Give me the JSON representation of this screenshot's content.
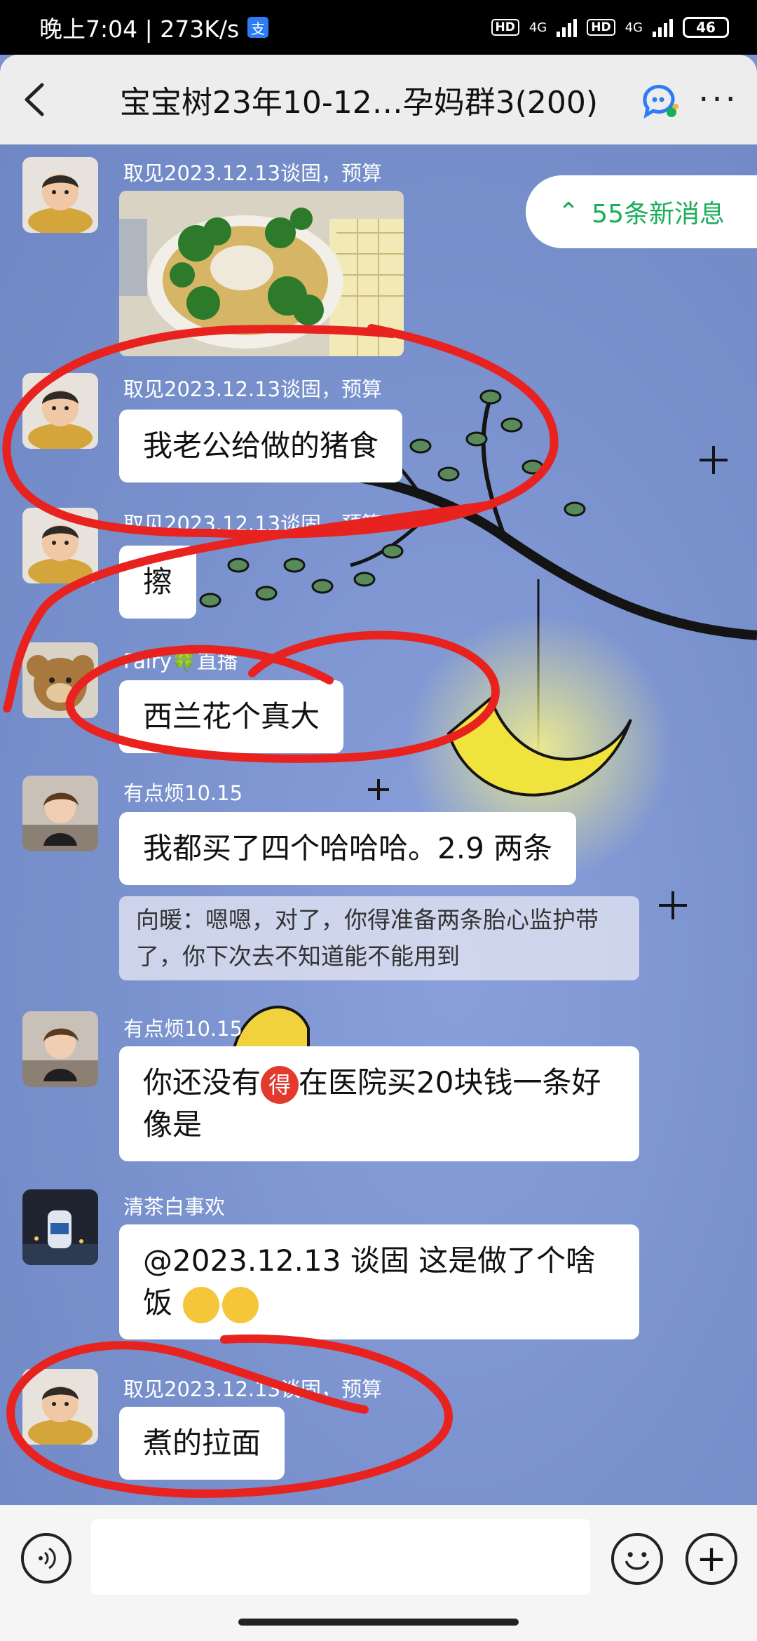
{
  "status_bar": {
    "time_speed": "晚上7:04 | 273K/s",
    "app_badge": "支",
    "hd1": "HD",
    "net1": "4G",
    "hd2": "HD",
    "net2": "4G",
    "battery": "46"
  },
  "header": {
    "back_icon": "‹",
    "title": "宝宝树23年10-12…孕妈群3(200)",
    "more_icon": "···"
  },
  "new_messages": {
    "arrow": "⌃",
    "label": "55条新消息"
  },
  "messages": [
    {
      "sender": "取见2023.12.13谈固，预算",
      "type": "image"
    },
    {
      "sender": "取见2023.12.13谈固，预算",
      "text": "我老公给做的猪食"
    },
    {
      "sender": "取见2023.12.13谈固，预算",
      "text": "擦"
    },
    {
      "sender": "Fairy🍀直播",
      "text": "西兰花个真大"
    },
    {
      "sender": "有点烦10.15",
      "text": "我都买了四个哈哈哈。2.9 两条",
      "quote": "向暖：嗯嗯，对了，你得准备两条胎心监护带了，你下次去不知道能不能用到"
    },
    {
      "sender": "有点烦10.15",
      "text_pre": "你还没有",
      "badge": "得",
      "text_post": "在医院买20块钱一条好像是"
    },
    {
      "sender": "清茶白事欢",
      "text": "@2023.12.13 谈固    这是做了个啥饭"
    },
    {
      "sender": "取见2023.12.13谈固，预算",
      "text": "煮的拉面"
    }
  ],
  "input_bar": {
    "voice_icon": "voice-icon",
    "placeholder": "",
    "emoji_icon": "emoji-icon",
    "plus_icon": "+"
  },
  "colors": {
    "accent_green": "#1aad5a",
    "chat_bg": "#7b93cf",
    "annotation_red": "#e8231f"
  }
}
